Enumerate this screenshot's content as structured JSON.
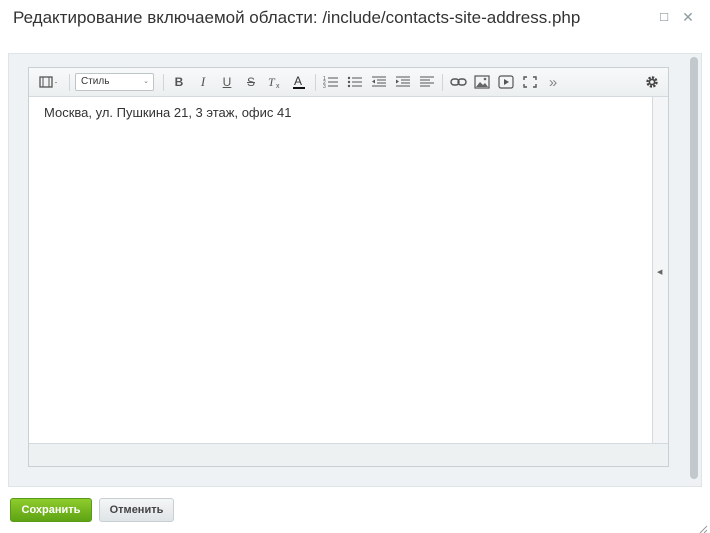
{
  "dialog": {
    "title": "Редактирование включаемой области: /include/contacts-site-address.php"
  },
  "toolbar": {
    "style_select": "Стиль",
    "bold": "B",
    "italic": "I",
    "underline": "U",
    "strike": "S",
    "more": "»"
  },
  "editor": {
    "content": "Москва, ул. Пушкина 21, 3 этаж, офис 41"
  },
  "actions": {
    "save": "Сохранить",
    "cancel": "Отменить"
  },
  "colors": {
    "save_button": "#6cb21f",
    "frame": "#eef2f4"
  }
}
